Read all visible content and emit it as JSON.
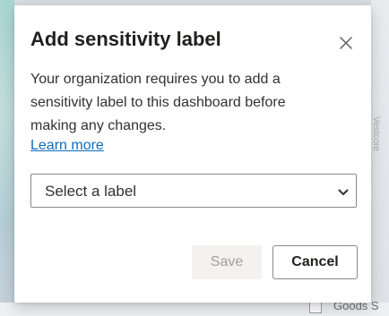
{
  "dialog": {
    "title": "Add sensitivity label",
    "message": "Your organization requires you to add a sensitivity label to this dashboard before making any changes.",
    "learn_more": "Learn more",
    "select": {
      "selected": "Select a label"
    },
    "buttons": {
      "save": "Save",
      "cancel": "Cancel"
    },
    "icons": {
      "close": "close-icon",
      "dropdown": "chevron-down-icon"
    }
  },
  "background": {
    "side_text": "Vestcore",
    "bottom_text": "Goods S"
  },
  "colors": {
    "link": "#0f6cbd",
    "title_text": "#201f1e",
    "body_text": "#323130",
    "disabled_button_bg": "#f3f2f1",
    "disabled_button_text": "#a19f9d"
  }
}
